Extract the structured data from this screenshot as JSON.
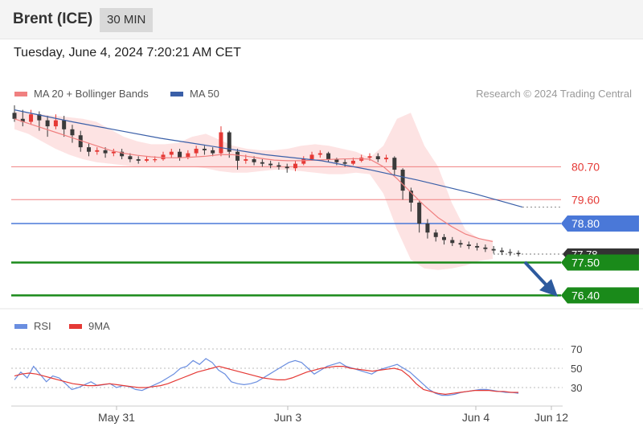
{
  "header": {
    "instrument": "Brent (ICE)",
    "timeframe": "30 MIN",
    "datetime": "Tuesday, June 4, 2024 7:20:21 AM CET"
  },
  "legend": {
    "ma20_label": "MA 20 + Bollinger Bands",
    "ma50_label": "MA 50",
    "copyright": "Research © 2024 Trading Central",
    "rsi_label": "RSI",
    "rsi_ma_label": "9MA"
  },
  "colors": {
    "ma20": "#f08080",
    "bollinger_fill": "#fde0e0",
    "ma50": "#3a5fa8",
    "candle_up": "#e53935",
    "candle_down": "#3a3a3a",
    "resistance": "#f08080",
    "pivot": "#4a78d8",
    "support": "#1a8a1a",
    "last_price_tag": "#333333",
    "arrow": "#2d5a9e",
    "rsi": "#6a8ee0",
    "rsi_ma": "#e53935"
  },
  "chart_data": [
    {
      "type": "candlestick",
      "title": "Brent (ICE)",
      "timeframe": "30 MIN",
      "x_ticks": [
        "May 31",
        "Jun 3",
        "Jun 4",
        "Jun 12"
      ],
      "ylim": [
        75.9,
        83.1
      ],
      "levels": [
        {
          "label": "80.70",
          "value": 80.7,
          "kind": "resistance"
        },
        {
          "label": "79.60",
          "value": 79.6,
          "kind": "resistance"
        },
        {
          "label": "78.80",
          "value": 78.8,
          "kind": "pivot"
        },
        {
          "label": "77.78",
          "value": 77.78,
          "kind": "last"
        },
        {
          "label": "77.50",
          "value": 77.5,
          "kind": "support"
        },
        {
          "label": "76.40",
          "value": 76.4,
          "kind": "support"
        }
      ],
      "candles": [
        [
          82.5,
          82.3,
          82.75,
          82.2
        ],
        [
          82.3,
          82.2,
          82.6,
          82.05
        ],
        [
          82.2,
          82.45,
          82.6,
          82.1
        ],
        [
          82.45,
          82.25,
          82.55,
          81.9
        ],
        [
          82.25,
          82.05,
          82.4,
          81.7
        ],
        [
          82.05,
          82.25,
          82.45,
          81.95
        ],
        [
          82.25,
          81.95,
          82.4,
          81.7
        ],
        [
          81.95,
          81.75,
          82.1,
          81.5
        ],
        [
          81.75,
          81.35,
          81.9,
          81.2
        ],
        [
          81.35,
          81.2,
          81.5,
          81.05
        ],
        [
          81.2,
          81.25,
          81.35,
          81.1
        ],
        [
          81.25,
          81.15,
          81.35,
          81.0
        ],
        [
          81.15,
          81.2,
          81.3,
          81.05
        ],
        [
          81.2,
          81.05,
          81.3,
          80.95
        ],
        [
          81.05,
          80.95,
          81.15,
          80.85
        ],
        [
          80.95,
          80.9,
          81.05,
          80.8
        ],
        [
          80.9,
          80.95,
          81.05,
          80.85
        ],
        [
          80.95,
          80.95,
          81.05,
          80.85
        ],
        [
          80.95,
          81.1,
          81.2,
          80.9
        ],
        [
          81.1,
          81.2,
          81.3,
          81.0
        ],
        [
          81.2,
          81.0,
          81.3,
          80.9
        ],
        [
          81.0,
          81.15,
          81.25,
          80.95
        ],
        [
          81.15,
          81.3,
          81.4,
          81.05
        ],
        [
          81.3,
          81.25,
          81.4,
          81.1
        ],
        [
          81.25,
          81.15,
          81.35,
          81.05
        ],
        [
          81.15,
          81.85,
          82.05,
          81.05
        ],
        [
          81.85,
          81.2,
          81.9,
          81.0
        ],
        [
          81.2,
          80.9,
          81.3,
          80.6
        ],
        [
          80.9,
          80.95,
          81.1,
          80.8
        ],
        [
          80.95,
          80.85,
          81.05,
          80.75
        ],
        [
          80.85,
          80.8,
          80.95,
          80.7
        ],
        [
          80.8,
          80.75,
          80.9,
          80.65
        ],
        [
          80.75,
          80.7,
          80.85,
          80.6
        ],
        [
          80.7,
          80.65,
          80.8,
          80.5
        ],
        [
          80.65,
          80.8,
          80.9,
          80.55
        ],
        [
          80.8,
          80.95,
          81.05,
          80.75
        ],
        [
          80.95,
          81.1,
          81.2,
          80.9
        ],
        [
          81.1,
          81.15,
          81.25,
          81.0
        ],
        [
          81.15,
          80.95,
          81.2,
          80.85
        ],
        [
          80.95,
          80.85,
          81.0,
          80.75
        ],
        [
          80.85,
          80.8,
          80.95,
          80.7
        ],
        [
          80.8,
          80.9,
          81.0,
          80.75
        ],
        [
          80.9,
          81.0,
          81.1,
          80.85
        ],
        [
          81.0,
          81.05,
          81.15,
          80.9
        ],
        [
          81.05,
          80.95,
          81.15,
          80.85
        ],
        [
          80.95,
          81.0,
          81.1,
          80.85
        ],
        [
          81.0,
          80.6,
          81.05,
          80.4
        ],
        [
          80.6,
          79.9,
          80.65,
          79.6
        ],
        [
          79.9,
          79.5,
          80.0,
          79.2
        ],
        [
          79.5,
          78.8,
          79.55,
          78.5
        ],
        [
          78.8,
          78.5,
          78.95,
          78.3
        ],
        [
          78.5,
          78.35,
          78.6,
          78.2
        ],
        [
          78.35,
          78.25,
          78.45,
          78.1
        ],
        [
          78.25,
          78.15,
          78.35,
          78.05
        ],
        [
          78.15,
          78.1,
          78.25,
          78.0
        ],
        [
          78.1,
          78.05,
          78.2,
          77.95
        ],
        [
          78.05,
          78.0,
          78.15,
          77.9
        ],
        [
          78.0,
          77.95,
          78.1,
          77.85
        ],
        [
          77.95,
          77.9,
          78.05,
          77.8
        ],
        [
          77.9,
          77.85,
          78.0,
          77.75
        ],
        [
          77.85,
          77.82,
          77.95,
          77.72
        ],
        [
          77.82,
          77.78,
          77.9,
          77.7
        ]
      ],
      "ma20": [
        82.3,
        82.15,
        82.0,
        81.85,
        81.7,
        81.55,
        81.4,
        81.25,
        81.15,
        81.08,
        81.03,
        81.0,
        81.0,
        81.02,
        81.05,
        81.1,
        81.1,
        81.05,
        80.98,
        80.92,
        80.9,
        80.9,
        80.92,
        80.94,
        80.96,
        80.97,
        80.95,
        80.7,
        80.3,
        79.85,
        79.4,
        79.0,
        78.7,
        78.45,
        78.3,
        78.2
      ],
      "ma20_x": [
        18,
        35,
        52,
        69,
        86,
        103,
        120,
        137,
        154,
        171,
        188,
        205,
        222,
        239,
        256,
        273,
        290,
        307,
        324,
        341,
        358,
        375,
        392,
        409,
        426,
        443,
        460,
        477,
        494,
        511,
        528,
        545,
        562,
        579,
        596,
        613
      ],
      "bollinger_upper": [
        82.55,
        82.5,
        82.45,
        82.4,
        82.35,
        82.3,
        82.2,
        81.95,
        81.7,
        81.55,
        81.45,
        81.45,
        81.5,
        81.7,
        81.8,
        81.6,
        81.4,
        81.3,
        81.25,
        81.25,
        81.3,
        81.4,
        81.45,
        81.4,
        81.3,
        81.2,
        81.0,
        81.4,
        82.3,
        82.5,
        81.4,
        80.7,
        79.5,
        78.6,
        78.3,
        78.25
      ],
      "bollinger_lower": [
        81.95,
        81.8,
        81.55,
        81.3,
        81.1,
        80.95,
        80.85,
        80.8,
        80.75,
        80.7,
        80.7,
        80.7,
        80.7,
        80.7,
        80.65,
        80.55,
        80.5,
        80.5,
        80.55,
        80.6,
        80.6,
        80.55,
        80.5,
        80.45,
        80.45,
        80.5,
        80.45,
        79.8,
        78.6,
        77.6,
        77.3,
        77.25,
        77.3,
        77.4,
        77.55,
        77.62
      ],
      "ma50": [
        82.6,
        82.2,
        81.9,
        81.65,
        81.4,
        81.1,
        80.9,
        80.6,
        80.25,
        79.8,
        79.35
      ],
      "ma50_x": [
        18,
        90,
        150,
        200,
        260,
        330,
        400,
        460,
        520,
        590,
        650
      ]
    },
    {
      "type": "line",
      "title": "RSI",
      "ylim": [
        20,
        75
      ],
      "y_ticks": [
        70,
        50,
        30
      ],
      "x_ticks": [
        "May 31",
        "Jun 3",
        "Jun 4",
        "Jun 12"
      ],
      "series": [
        {
          "name": "RSI",
          "values": [
            38,
            46,
            40,
            52,
            44,
            36,
            42,
            40,
            34,
            28,
            30,
            33,
            36,
            32,
            33,
            34,
            30,
            32,
            31,
            28,
            27,
            30,
            33,
            36,
            40,
            44,
            50,
            52,
            58,
            54,
            60,
            56,
            48,
            44,
            36,
            34,
            33,
            34,
            36,
            40,
            44,
            48,
            52,
            56,
            58,
            56,
            50,
            44,
            48,
            52,
            54,
            56,
            52,
            50,
            48,
            46,
            44,
            48,
            50,
            52,
            54,
            50,
            46,
            40,
            34,
            28,
            24,
            22,
            22,
            23,
            25,
            26,
            27,
            28,
            28,
            27,
            26,
            25,
            25,
            24
          ]
        },
        {
          "name": "9MA",
          "values": [
            42,
            44,
            45,
            44,
            42,
            40,
            38,
            36,
            34,
            33,
            32,
            32,
            33,
            34,
            33,
            32,
            31,
            30,
            30,
            31,
            32,
            34,
            37,
            40,
            43,
            46,
            48,
            50,
            52,
            50,
            48,
            46,
            44,
            42,
            40,
            39,
            38,
            38,
            40,
            43,
            46,
            48,
            50,
            51,
            52,
            52,
            50,
            49,
            48,
            47,
            48,
            49,
            50,
            48,
            42,
            34,
            28,
            26,
            24,
            23,
            24,
            25,
            26,
            27,
            27,
            27,
            26,
            26,
            25,
            25
          ]
        }
      ]
    }
  ]
}
